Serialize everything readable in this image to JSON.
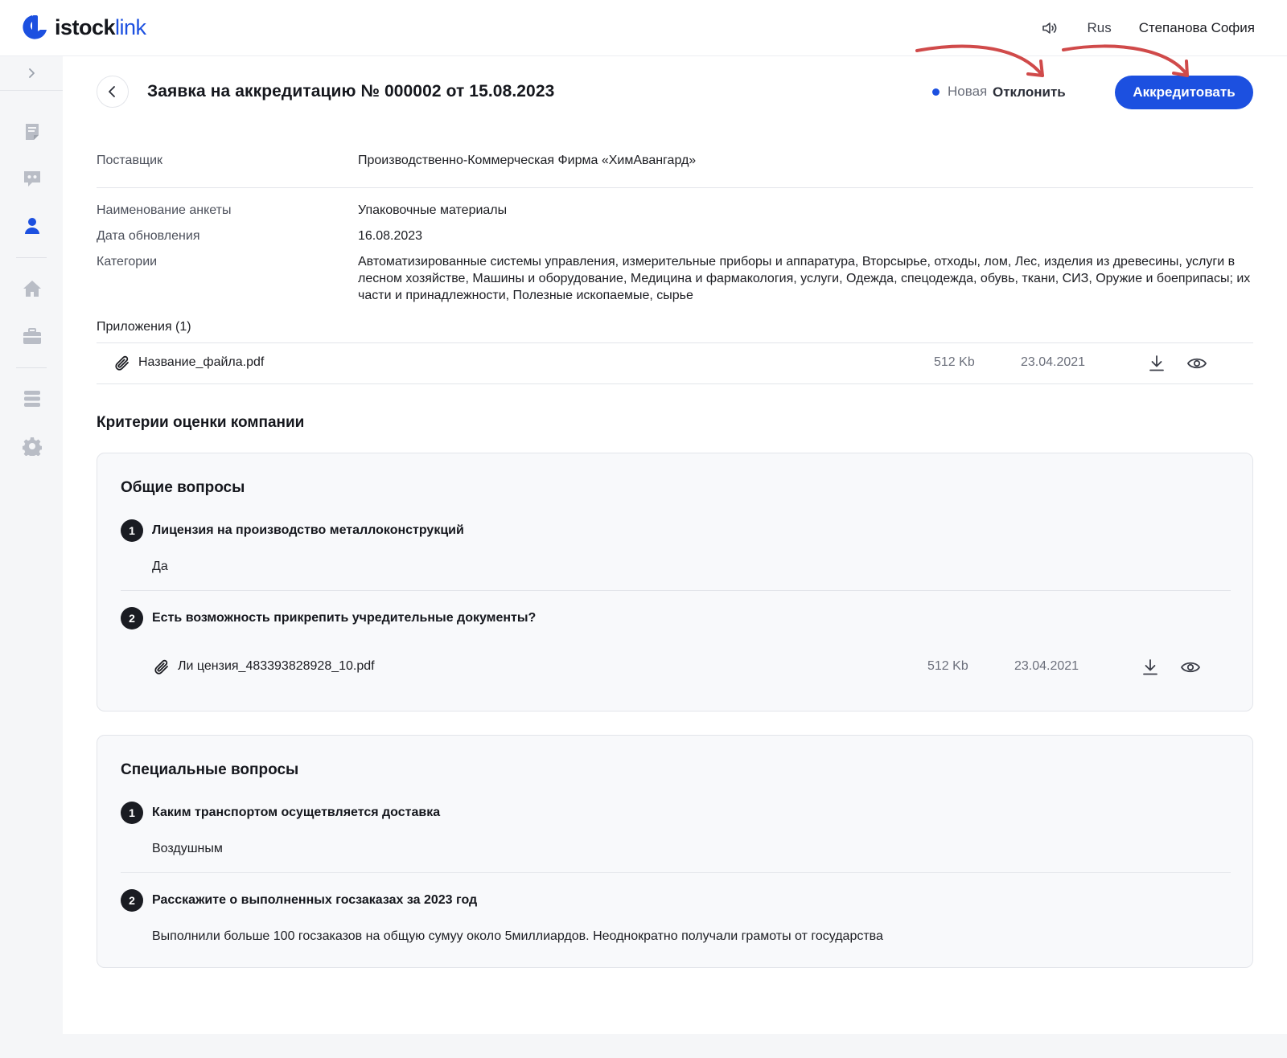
{
  "header": {
    "logo_part1": "istock",
    "logo_part2": "link",
    "sound_icon": "speaker-icon",
    "language": "Rus",
    "user_name": "Степанова София"
  },
  "sidebar": {
    "items": [
      {
        "icon": "document-icon",
        "active": false
      },
      {
        "icon": "chat-icon",
        "active": false
      },
      {
        "icon": "user-icon",
        "active": true
      },
      {
        "icon": "home-icon",
        "active": false
      },
      {
        "icon": "briefcase-icon",
        "active": false
      },
      {
        "icon": "database-icon",
        "active": false
      },
      {
        "icon": "gear-icon",
        "active": false
      }
    ]
  },
  "page": {
    "title": "Заявка на аккредитацию № 000002 от 15.08.2023",
    "status": "Новая",
    "reject_label": "Отклонить",
    "accredit_label": "Аккредитовать"
  },
  "details": {
    "supplier_label": "Поставщик",
    "supplier_value": "Производственно-Коммерческая Фирма «ХимАвангард»",
    "form_name_label": "Наименование анкеты",
    "form_name_value": "Упаковочные материалы",
    "updated_label": "Дата обновления",
    "updated_value": "16.08.2023",
    "categories_label": "Категории",
    "categories_value": "Автоматизированные системы управления, измерительные приборы и аппаратура, Вторсырье, отходы, лом, Лес, изделия из древесины, услуги в лесном хозяйстве, Машины и оборудование, Медицина и фармакология, услуги, Одежда, спецодежда, обувь, ткани, СИЗ, Оружие и боеприпасы; их части и принадлежности, Полезные ископаемые, сырье"
  },
  "attachments": {
    "title": "Приложения (1)",
    "files": [
      {
        "name": "Название_файла.pdf",
        "size": "512 Kb",
        "date": "23.04.2021"
      }
    ]
  },
  "criteria": {
    "title": "Критерии оценки компании",
    "sections": [
      {
        "title": "Общие вопросы",
        "questions": [
          {
            "num": "1",
            "text": "Лицензия на производство металлоконструкций",
            "answer": "Да"
          },
          {
            "num": "2",
            "text": "Есть возможность прикрепить учредительные документы?",
            "file": {
              "name": "Ли цензия_483393828928_10.pdf",
              "size": "512 Kb",
              "date": "23.04.2021"
            }
          }
        ]
      },
      {
        "title": "Специальные вопросы",
        "questions": [
          {
            "num": "1",
            "text": "Каким транспортом осущетвляется доставка",
            "answer": "Воздушным"
          },
          {
            "num": "2",
            "text": "Расскажите о выполненных госзаказах за 2023 год",
            "answer": "Выполнили больше 100 госзаказов на общую сумуу около 5миллиардов. Неоднократно получали грамоты от государства"
          }
        ]
      }
    ]
  },
  "colors": {
    "accent": "#1c50e0",
    "annotation_arrow": "#d04a4a",
    "sidebar_icon": "#b9bdc6"
  }
}
